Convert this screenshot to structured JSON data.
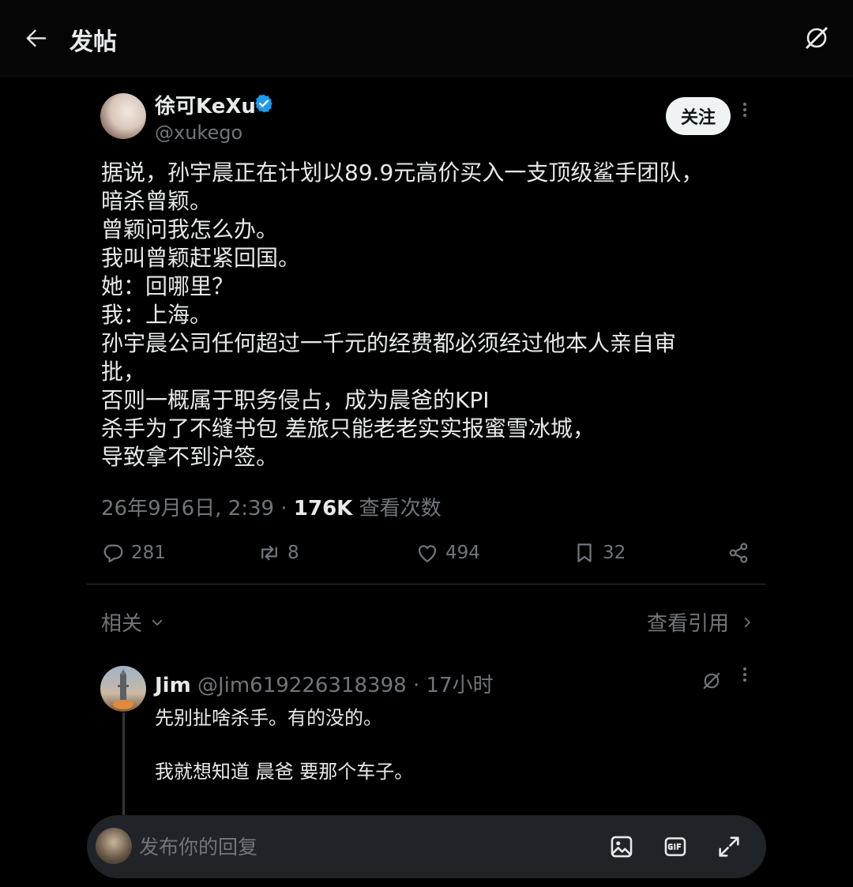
{
  "header": {
    "title": "发帖"
  },
  "post": {
    "author": {
      "name": "徐可KeXu",
      "handle": "@xukego",
      "verified": true
    },
    "follow_label": "关注",
    "lines": [
      "据说，孙宇晨正在计划以89.9元高价买入一支顶级鲨手团队，",
      "暗杀曾颖。",
      "曾颖问我怎么办。",
      "我叫曾颖赶紧回国。",
      "她：回哪里？",
      "我：上海。",
      "孙宇晨公司任何超过一千元的经费都必须经过他本人亲自审",
      "批，",
      "否则一概属于职务侵占，成为晨爸的KPI",
      "杀手为了不缝书包 差旅只能老老实实报蜜雪冰城，",
      "导致拿不到沪签。"
    ],
    "timestamp": "26年9月6日, 2:39",
    "separator": " · ",
    "views": "176K",
    "views_label": " 查看次数",
    "stats": {
      "replies": "281",
      "reposts": "8",
      "likes": "494",
      "bookmarks": "32"
    }
  },
  "filters": {
    "sort_label": "相关",
    "quotes_label": "查看引用"
  },
  "reply": {
    "name": "Jim",
    "handle": "@Jim619226318398",
    "time": " · 17小时",
    "text_line1": "先别扯啥杀手。有的没的。",
    "text_line2": "我就想知道 晨爸 要那个车子。"
  },
  "composer": {
    "placeholder": "发布你的回复"
  },
  "colors": {
    "background": "#000000",
    "text": "#e7e9ea",
    "muted": "#71767b",
    "verified": "#1d9bf0",
    "composer": "#202327"
  }
}
